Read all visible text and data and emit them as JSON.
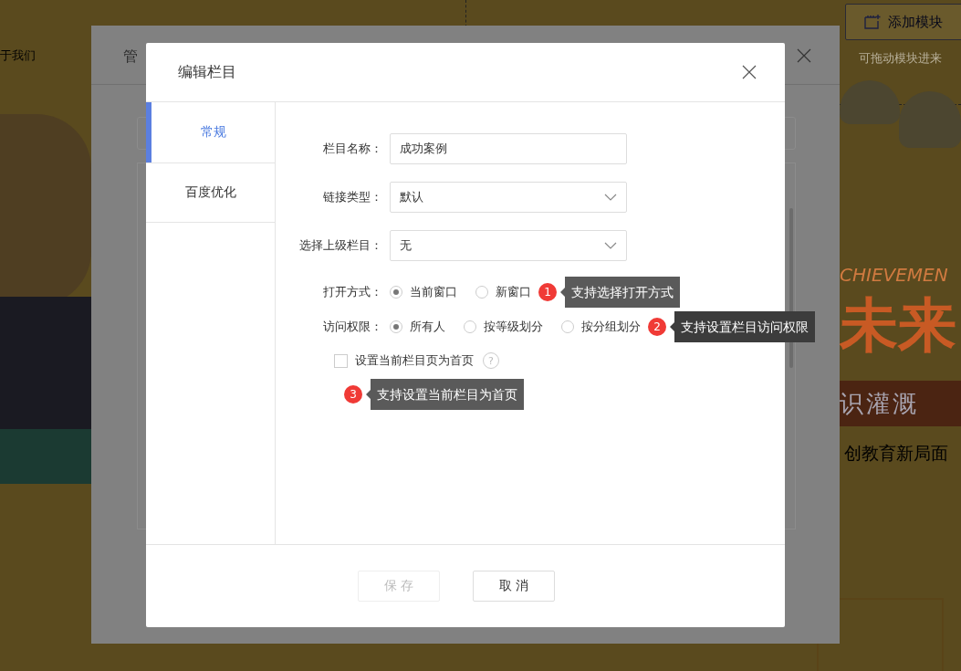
{
  "background_page": {
    "nav_items": [
      "于我们"
    ],
    "add_module_button": "添加模块",
    "drag_hint": "可拖动模块进来",
    "banner": {
      "english_text": "CHIEVEMEN",
      "headline": "未来",
      "ribbon_text": "识灌溉",
      "slogan": "创教育新局面"
    }
  },
  "manage_dialog": {
    "title": "管"
  },
  "dialog": {
    "title": "编辑栏目",
    "tabs": [
      {
        "label": "常规",
        "selected": true
      },
      {
        "label": "百度优化",
        "selected": false
      }
    ],
    "fields": [
      {
        "kind": "text",
        "label": "栏目名称：",
        "value": "成功案例"
      },
      {
        "kind": "select",
        "label": "链接类型：",
        "value": "默认"
      },
      {
        "kind": "select",
        "label": "选择上级栏目：",
        "value": "无"
      }
    ],
    "radio_groups": [
      {
        "label": "打开方式：",
        "options": [
          {
            "label": "当前窗口",
            "selected": true
          },
          {
            "label": "新窗口",
            "selected": false
          }
        ],
        "tip": {
          "number": "1",
          "text": "支持选择打开方式"
        }
      },
      {
        "label": "访问权限：",
        "options": [
          {
            "label": "所有人",
            "selected": true
          },
          {
            "label": "按等级划分",
            "selected": false
          },
          {
            "label": "按分组划分",
            "selected": false
          }
        ],
        "tip": {
          "number": "2",
          "text": "支持设置栏目访问权限"
        }
      }
    ],
    "homepage_checkbox": {
      "label": "设置当前栏目页为首页",
      "checked": false,
      "help": "?",
      "tip": {
        "number": "3",
        "text": "支持设置当前栏目为首页"
      }
    },
    "buttons": [
      {
        "label": "保存",
        "disabled": true
      },
      {
        "label": "取消",
        "disabled": false
      }
    ]
  }
}
